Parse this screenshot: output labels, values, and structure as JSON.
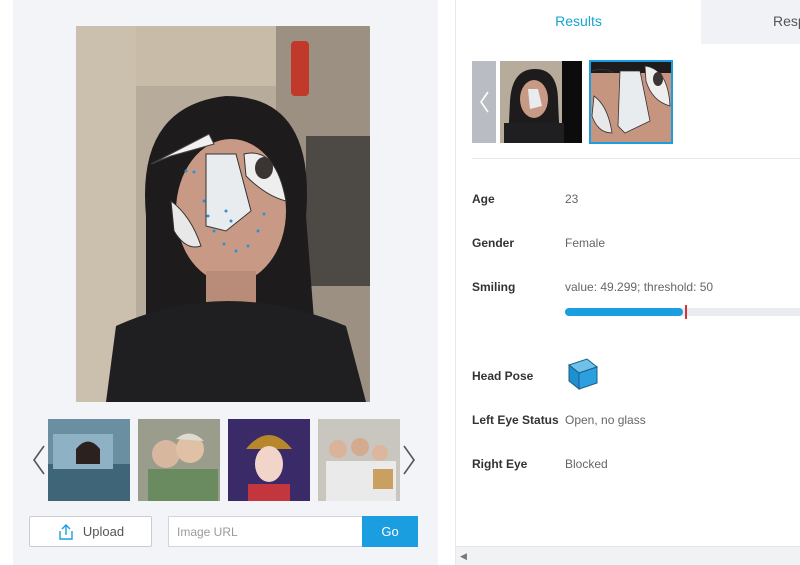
{
  "left_panel": {
    "upload_label": "Upload",
    "url_placeholder": "Image URL",
    "go_label": "Go",
    "thumbnails": [
      "car-photo",
      "elderly-couple-photo",
      "opera-portrait-photo",
      "family-photo"
    ]
  },
  "right_panel": {
    "tabs": [
      {
        "label": "Results",
        "active": true
      },
      {
        "label": "Resp",
        "active": false
      }
    ],
    "attributes": {
      "age": {
        "label": "Age",
        "value": "23"
      },
      "gender": {
        "label": "Gender",
        "value": "Female"
      },
      "smiling": {
        "label": "Smiling",
        "value": "value: 49.299; threshold: 50",
        "score": 49.299,
        "threshold": 50
      },
      "head_pose": {
        "label": "Head Pose",
        "icon": "cube-icon"
      },
      "left_eye": {
        "label": "Left Eye Status",
        "value": "Open, no glass"
      },
      "right_eye": {
        "label": "Right Eye",
        "value": "Blocked"
      }
    }
  },
  "colors": {
    "accent": "#1a9ee0",
    "tab_active_text": "#19a3cf",
    "threshold_marker": "#d0353a"
  }
}
